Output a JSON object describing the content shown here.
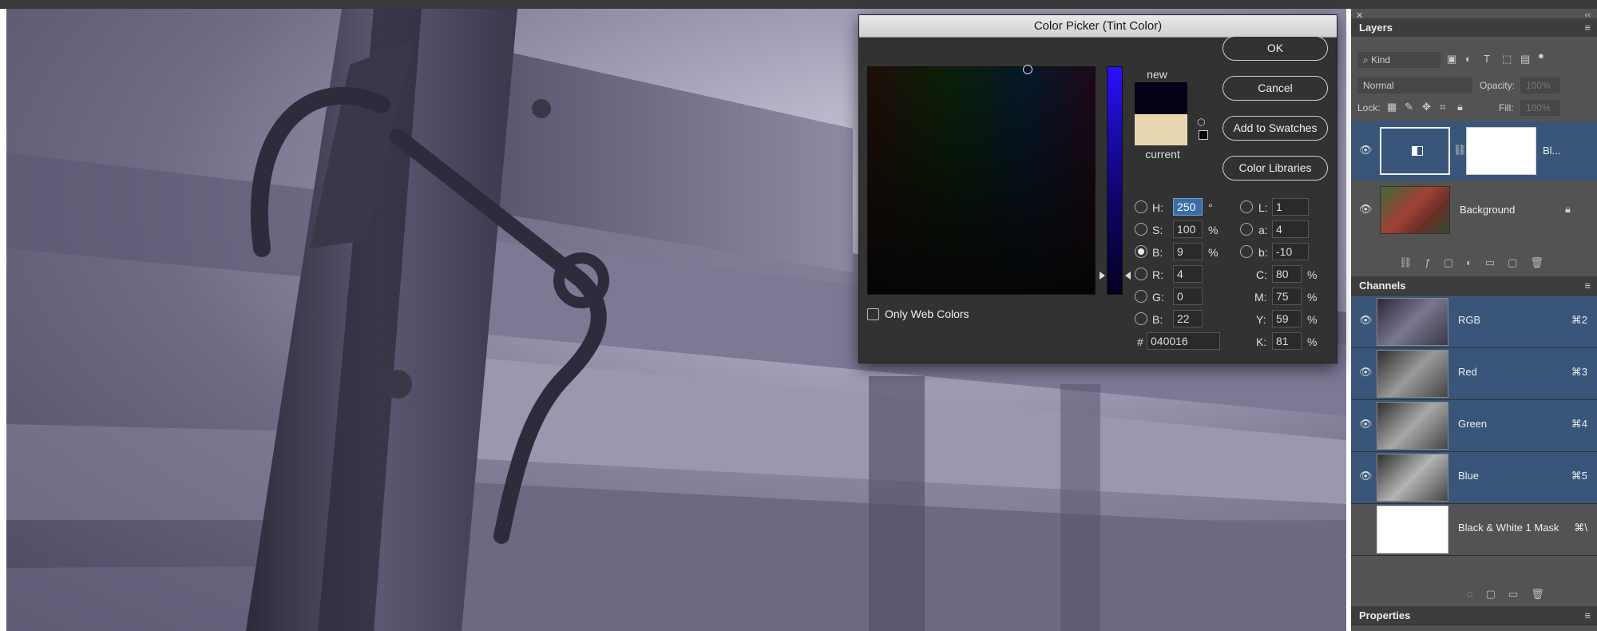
{
  "dialog": {
    "title": "Color Picker (Tint Color)",
    "label_new": "new",
    "label_current": "current",
    "new_color": "#040016",
    "current_color": "#e8d6ae",
    "buttons": {
      "ok": "OK",
      "cancel": "Cancel",
      "add_swatches": "Add to Swatches",
      "color_libraries": "Color Libraries"
    },
    "only_web_colors": "Only Web Colors",
    "fields": {
      "h": {
        "label": "H:",
        "value": "250",
        "unit": "°"
      },
      "s": {
        "label": "S:",
        "value": "100",
        "unit": "%"
      },
      "b": {
        "label": "B:",
        "value": "9",
        "unit": "%"
      },
      "r": {
        "label": "R:",
        "value": "4"
      },
      "g": {
        "label": "G:",
        "value": "0"
      },
      "bl": {
        "label": "B:",
        "value": "22"
      },
      "l": {
        "label": "L:",
        "value": "1"
      },
      "a": {
        "label": "a:",
        "value": "4"
      },
      "lb": {
        "label": "b:",
        "value": "-10"
      },
      "c": {
        "label": "C:",
        "value": "80",
        "unit": "%"
      },
      "m": {
        "label": "M:",
        "value": "75",
        "unit": "%"
      },
      "y": {
        "label": "Y:",
        "value": "59",
        "unit": "%"
      },
      "k": {
        "label": "K:",
        "value": "81",
        "unit": "%"
      },
      "hex_label": "#",
      "hex": "040016"
    }
  },
  "layers": {
    "title": "Layers",
    "kind_filter": "Kind",
    "blend_mode": "Normal",
    "opacity_label": "Opacity:",
    "opacity_value": "100%",
    "lock_label": "Lock:",
    "fill_label": "Fill:",
    "fill_value": "100%",
    "items": [
      {
        "name": "Bl..."
      },
      {
        "name": "Background"
      }
    ]
  },
  "channels": {
    "title": "Channels",
    "items": [
      {
        "name": "RGB",
        "shortcut": "⌘2"
      },
      {
        "name": "Red",
        "shortcut": "⌘3"
      },
      {
        "name": "Green",
        "shortcut": "⌘4"
      },
      {
        "name": "Blue",
        "shortcut": "⌘5"
      },
      {
        "name": "Black & White 1 Mask",
        "shortcut": "⌘\\"
      }
    ]
  },
  "properties": {
    "title": "Properties"
  }
}
